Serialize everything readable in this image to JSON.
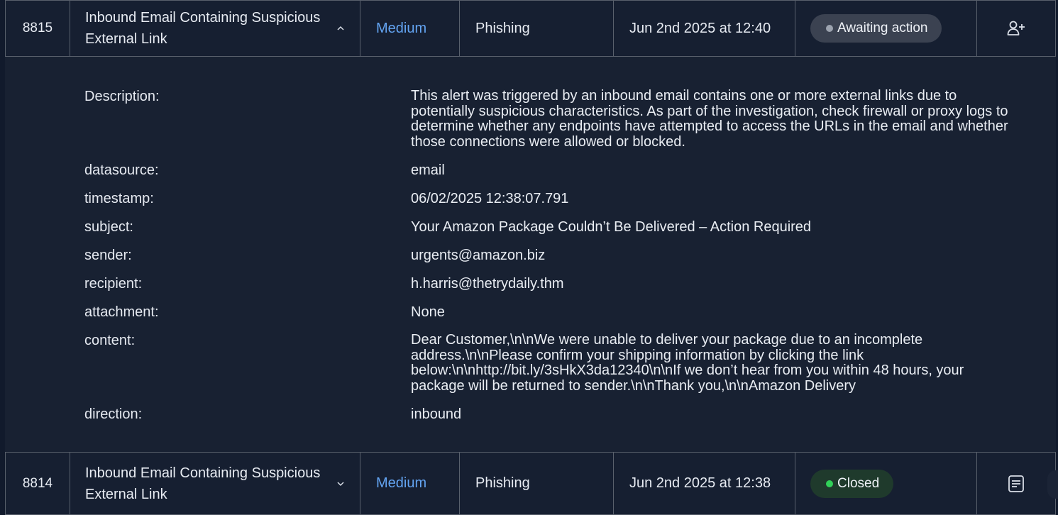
{
  "rows": [
    {
      "id": "8815",
      "title": "Inbound Email Containing Suspicious External Link",
      "severity": "Medium",
      "type": "Phishing",
      "time": "Jun 2nd 2025 at 12:40",
      "status": "Awaiting action",
      "status_color": "#9ca3af",
      "action_icon": "user-plus-icon",
      "expanded": true
    },
    {
      "id": "8814",
      "title": "Inbound Email Containing Suspicious External Link",
      "severity": "Medium",
      "type": "Phishing",
      "time": "Jun 2nd 2025 at 12:38",
      "status": "Closed",
      "status_color": "#31d158",
      "action_icon": "report-icon",
      "expanded": false
    }
  ],
  "details": {
    "description_label": "Description:",
    "description": "This alert was triggered by an inbound email contains one or more external links due to potentially suspicious characteristics. As part of the investigation, check firewall or proxy logs to determine whether any endpoints have attempted to access the URLs in the email and whether those connections were allowed or blocked.",
    "datasource_label": "datasource:",
    "datasource": "email",
    "timestamp_label": "timestamp:",
    "timestamp": "06/02/2025 12:38:07.791",
    "subject_label": "subject:",
    "subject": "Your Amazon Package Couldn’t Be Delivered – Action Required",
    "sender_label": "sender:",
    "sender": "urgents@amazon.biz",
    "recipient_label": "recipient:",
    "recipient": "h.harris@thetrydaily.thm",
    "attachment_label": "attachment:",
    "attachment": "None",
    "content_label": "content:",
    "content": "Dear Customer,\\n\\nWe were unable to deliver your package due to an incomplete address.\\n\\nPlease confirm your shipping information by clicking the link below:\\n\\nhttp://bit.ly/3sHkX3da12340\\n\\nIf we don’t hear from you within 48 hours, your package will be returned to sender.\\n\\nThank you,\\n\\nAmazon Delivery",
    "direction_label": "direction:",
    "direction": "inbound"
  },
  "colors": {
    "severity_medium": "#63a4f2",
    "row_bg": "#161f31",
    "detail_bg": "#182132",
    "border": "#59606c"
  }
}
